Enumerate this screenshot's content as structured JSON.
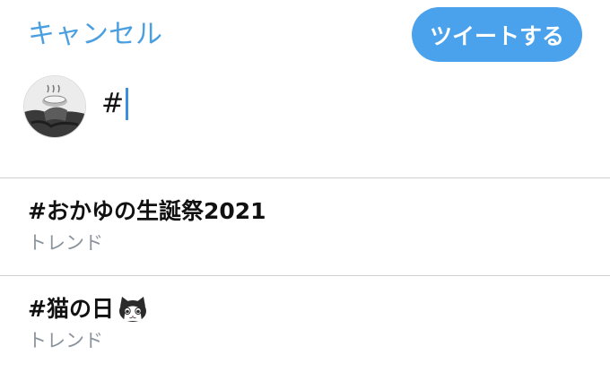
{
  "header": {
    "cancel_label": "キャンセル",
    "tweet_label": "ツイートする"
  },
  "compose": {
    "text": "#"
  },
  "suggestions": [
    {
      "title": "#おかゆの生誕祭2021",
      "subtitle": "トレンド"
    },
    {
      "title": "#猫の日",
      "subtitle": "トレンド",
      "emoji": "cat-face-icon"
    }
  ],
  "colors": {
    "accent": "#4aa1ec",
    "link": "#4a9fe0",
    "secondary_text": "#8a939c",
    "divider": "#cfcfcf"
  }
}
